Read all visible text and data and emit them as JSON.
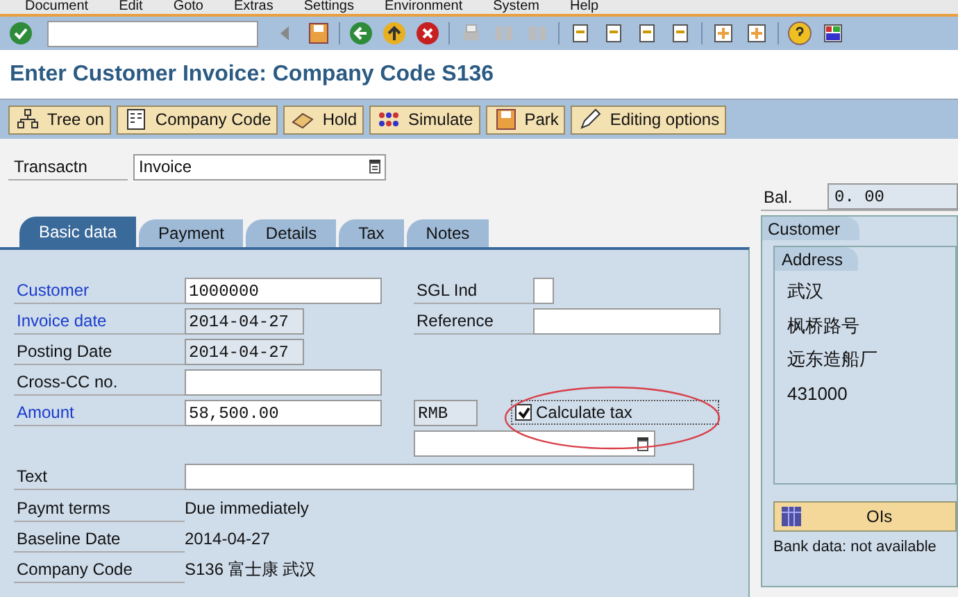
{
  "menu": [
    "Document",
    "Edit",
    "Goto",
    "Extras",
    "Settings",
    "Environment",
    "System",
    "Help"
  ],
  "title": "Enter Customer Invoice: Company Code S136",
  "app_toolbar": [
    "Tree on",
    "Company Code",
    "Hold",
    "Simulate",
    "Park",
    "Editing options"
  ],
  "transaction": {
    "label": "Transactn",
    "value": "Invoice"
  },
  "tabs": [
    {
      "label": "Basic data",
      "selected": true
    },
    {
      "label": "Payment",
      "selected": false
    },
    {
      "label": "Details",
      "selected": false
    },
    {
      "label": "Tax",
      "selected": false
    },
    {
      "label": "Notes",
      "selected": false
    }
  ],
  "fields": [
    {
      "label": "Customer",
      "required": true,
      "kind": "input",
      "value": "1000000"
    },
    {
      "label": "Invoice date",
      "required": true,
      "kind": "display",
      "value": "2014-04-27"
    },
    {
      "label": "Posting Date",
      "required": false,
      "kind": "display",
      "value": "2014-04-27"
    },
    {
      "label": "Cross-CC no.",
      "required": false,
      "kind": "input"
    },
    {
      "label": "Amount",
      "required": true,
      "kind": "input",
      "value": "58,500.00"
    }
  ],
  "sgl_ind": {
    "label": "SGL Ind"
  },
  "reference": {
    "label": "Reference"
  },
  "currency": "RMB",
  "calculate_tax": {
    "label": "Calculate tax",
    "checked": true
  },
  "text": {
    "label": "Text"
  },
  "info": [
    {
      "label": "Paymt terms",
      "value": "Due immediately"
    },
    {
      "label": "Baseline Date",
      "value": "2014-04-27"
    },
    {
      "label": "Company Code",
      "value": "S136 富士康 武汉"
    }
  ],
  "balance": {
    "label": "Bal.",
    "value": "0. 00"
  },
  "customer_panel": {
    "tab": "Customer",
    "subtab": "Address",
    "address": [
      "武汉",
      "枫桥路号",
      "远东造船厂",
      "431000"
    ],
    "button": "OIs",
    "bank_data": "Bank data: not available"
  }
}
